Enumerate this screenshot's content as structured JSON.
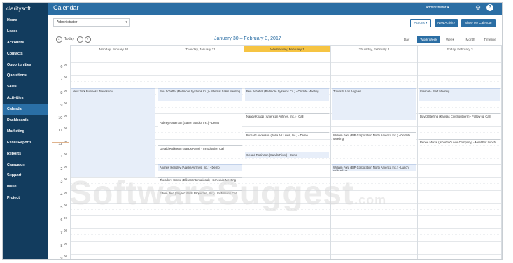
{
  "app": {
    "logo": "claritysoft",
    "page_title": "Calendar"
  },
  "sidebar": {
    "items": [
      {
        "label": "Home",
        "active": false
      },
      {
        "label": "Leads",
        "active": false
      },
      {
        "label": "Accounts",
        "active": false
      },
      {
        "label": "Contacts",
        "active": false
      },
      {
        "label": "Opportunities",
        "active": false
      },
      {
        "label": "Quotations",
        "active": false
      },
      {
        "label": "Sales",
        "active": false
      },
      {
        "label": "Activities",
        "active": false
      },
      {
        "label": "Calendar",
        "active": true
      },
      {
        "label": "Dashboards",
        "active": false
      },
      {
        "label": "Marketing",
        "active": false
      },
      {
        "label": "Excel Reports",
        "active": false
      },
      {
        "label": "Reports",
        "active": false
      },
      {
        "label": "Campaign",
        "active": false
      },
      {
        "label": "Support",
        "active": false
      },
      {
        "label": "Issue",
        "active": false
      },
      {
        "label": "Project",
        "active": false
      }
    ]
  },
  "topbar": {
    "user": "Administrator ▾",
    "gear_icon": "gear-icon",
    "help_icon": "help-icon",
    "help_glyph": "?"
  },
  "toolbar": {
    "user_select_value": "Administrator",
    "actions_label": "Actions ▾",
    "new_activity_label": "New Activity",
    "show_my_calendar_label": "Show My Calendar"
  },
  "nav": {
    "prev_icon": "back-circle-icon",
    "today_label": "Today",
    "left_icon": "chevron-left-icon",
    "right_icon": "chevron-right-icon",
    "date_range": "January 30 – February 3, 2017",
    "views": [
      {
        "label": "Day",
        "active": false
      },
      {
        "label": "Work Week",
        "active": true
      },
      {
        "label": "Week",
        "active": false
      },
      {
        "label": "Month",
        "active": false
      },
      {
        "label": "Timeline",
        "active": false
      }
    ]
  },
  "calendar": {
    "days": [
      {
        "label": "Monday, January 30",
        "today": false
      },
      {
        "label": "Tuesday, January 31",
        "today": false
      },
      {
        "label": "Wednesday, February 1",
        "today": true
      },
      {
        "label": "Thursday, February 2",
        "today": false
      },
      {
        "label": "Friday, February 3",
        "today": false
      }
    ],
    "hours": [
      {
        "h": "6",
        "m": "00"
      },
      {
        "h": "7",
        "m": "00"
      },
      {
        "h": "8",
        "m": "00"
      },
      {
        "h": "9",
        "m": "00"
      },
      {
        "h": "10",
        "m": "00"
      },
      {
        "h": "11",
        "m": "00"
      },
      {
        "h": "12",
        "m": "00"
      },
      {
        "h": "1",
        "m": "00"
      },
      {
        "h": "2",
        "m": "00"
      },
      {
        "h": "3",
        "m": "00"
      },
      {
        "h": "4",
        "m": "00"
      },
      {
        "h": "5",
        "m": "00"
      },
      {
        "h": "6",
        "m": "00"
      },
      {
        "h": "7",
        "m": "00"
      },
      {
        "h": "8",
        "m": "00"
      },
      {
        "h": "9",
        "m": "00"
      }
    ],
    "events": [
      {
        "day": 0,
        "start": 8.0,
        "end": 15.0,
        "title": "New York Business Tradeshow",
        "style": "blue"
      },
      {
        "day": 1,
        "start": 8.0,
        "end": 9.0,
        "title": "Ben Schaffer (Beltmore Systems Co.) - Internal Sales Meeting",
        "style": "blue"
      },
      {
        "day": 1,
        "start": 10.5,
        "end": 11.5,
        "title": "Aubrey Patterson (Saxon Studio, Inc.) - Demo",
        "style": "plain"
      },
      {
        "day": 1,
        "start": 12.5,
        "end": 13.0,
        "title": "Gerald Robinson (Sands River) - Introduction Call",
        "style": "plain"
      },
      {
        "day": 1,
        "start": 14.0,
        "end": 14.5,
        "title": "Andrew Hensley (Alaska Airlines, Inc.) - Demo",
        "style": "blue"
      },
      {
        "day": 1,
        "start": 15.0,
        "end": 15.5,
        "title": "Theodore Crowe (Ellison International) - Schedule Meeting",
        "style": "plain"
      },
      {
        "day": 1,
        "start": 16.0,
        "end": 16.5,
        "title": "Edwin Pike (Bayard Wells Properties, Inc.) - Installation Call",
        "style": "plain"
      },
      {
        "day": 2,
        "start": 8.0,
        "end": 9.0,
        "title": "Ben Schaffer (Beltmore Systems Co.) - On Site Meeting",
        "style": "blue"
      },
      {
        "day": 2,
        "start": 10.0,
        "end": 10.5,
        "title": "Nancy Knapp (American Airlines, Inc.) - Call",
        "style": "plain"
      },
      {
        "day": 2,
        "start": 11.5,
        "end": 12.0,
        "title": "Richard Anderson (Bella Air Lines, Inc.) - Demo",
        "style": "plain"
      },
      {
        "day": 2,
        "start": 13.0,
        "end": 13.5,
        "title": "Gerald Robinson (Sands River) - Demo",
        "style": "blue"
      },
      {
        "day": 3,
        "start": 8.0,
        "end": 10.5,
        "title": "Travel to Los Angeles",
        "style": "blue"
      },
      {
        "day": 3,
        "start": 11.5,
        "end": 12.5,
        "title": "William Ford (BIP Corporation North America Inc.) - On Site Meeting",
        "style": "plain"
      },
      {
        "day": 3,
        "start": 14.0,
        "end": 14.5,
        "title": "William Ford (BIP Corporation North America Inc.) - Lunch With Client",
        "style": "blue"
      },
      {
        "day": 4,
        "start": 8.0,
        "end": 9.0,
        "title": "Internal - Staff Meeting",
        "style": "blue"
      },
      {
        "day": 4,
        "start": 10.0,
        "end": 10.5,
        "title": "David Sterling (Kansas City Southern) - Follow up Call",
        "style": "plain"
      },
      {
        "day": 4,
        "start": 12.0,
        "end": 12.5,
        "title": "Renee Morse (Alberto-Culver Company) - Meet For Lunch",
        "style": "plain"
      }
    ]
  },
  "watermark": {
    "main": "SoftwareSuggest",
    "suffix": ".com"
  }
}
